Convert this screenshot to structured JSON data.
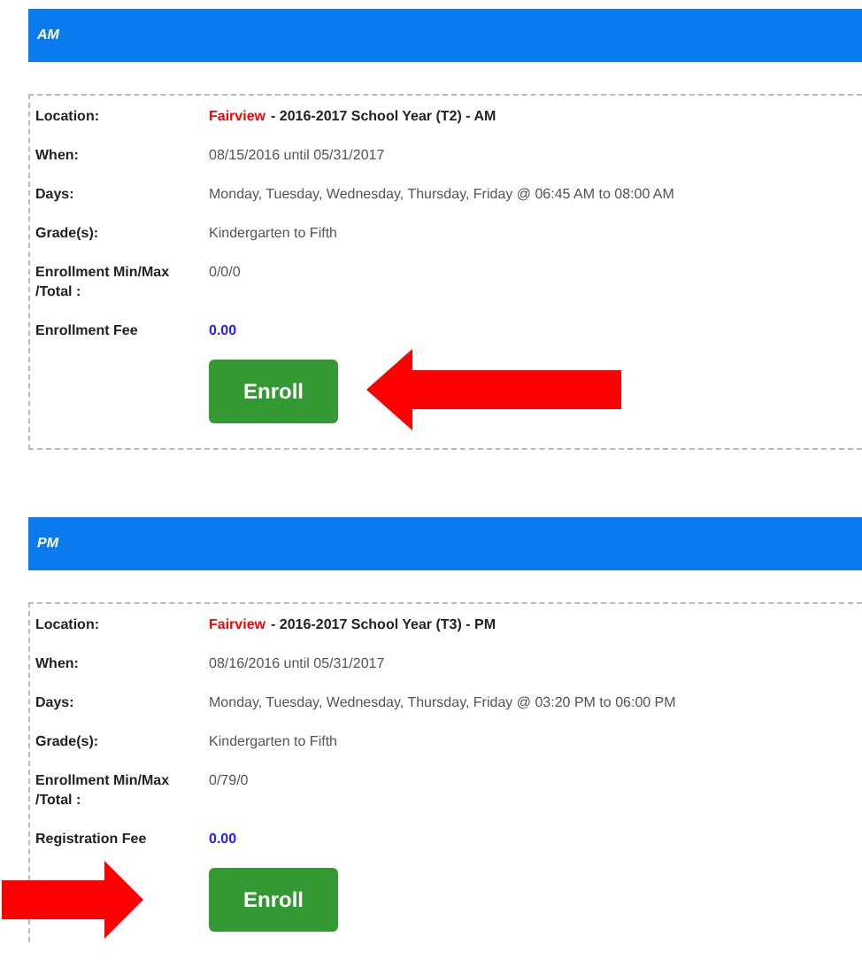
{
  "sections": [
    {
      "title": "AM",
      "location": {
        "label": "Location:",
        "place": "Fairview",
        "detail": "- 2016-2017 School Year (T2) - AM"
      },
      "rows": [
        {
          "label": "When:",
          "value": "08/15/2016 until 05/31/2017"
        },
        {
          "label": "Days:",
          "value": "Monday, Tuesday, Wednesday, Thursday, Friday @ 06:45 AM to 08:00 AM"
        },
        {
          "label": "Grade(s):",
          "value": "Kindergarten to Fifth"
        },
        {
          "label": "Enrollment Min/Max /Total :",
          "value": "0/0/0"
        }
      ],
      "fee": {
        "label": "Enrollment Fee",
        "value": "0.00"
      },
      "button": "Enroll",
      "arrow": {
        "kind": "left"
      }
    },
    {
      "title": "PM",
      "location": {
        "label": "Location:",
        "place": "Fairview",
        "detail": "- 2016-2017 School Year (T3) - PM"
      },
      "rows": [
        {
          "label": "When:",
          "value": "08/16/2016 until 05/31/2017"
        },
        {
          "label": "Days:",
          "value": "Monday, Tuesday, Wednesday, Thursday, Friday @ 03:20 PM to 06:00 PM"
        },
        {
          "label": "Grade(s):",
          "value": "Kindergarten to Fifth"
        },
        {
          "label": "Enrollment Min/Max /Total :",
          "value": "0/79/0"
        }
      ],
      "fee": {
        "label": "Registration Fee",
        "value": "0.00"
      },
      "button": "Enroll",
      "arrow": {
        "kind": "right"
      }
    }
  ]
}
